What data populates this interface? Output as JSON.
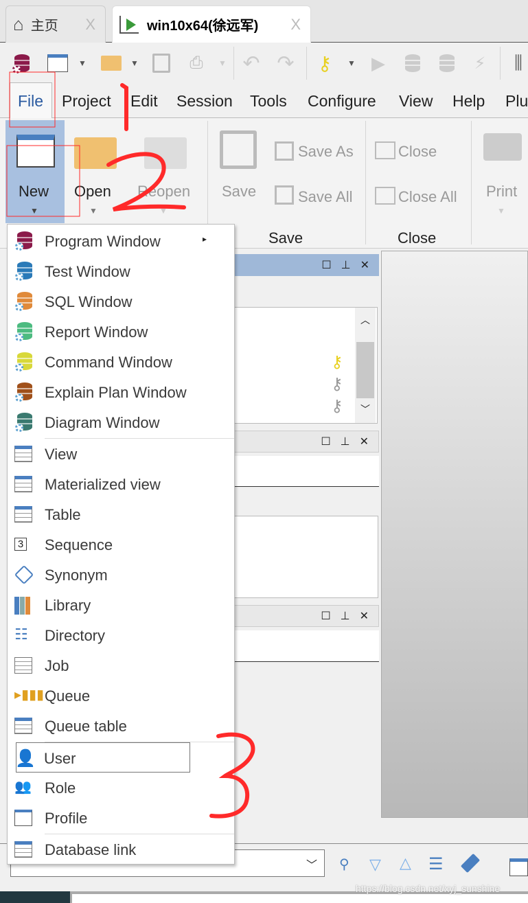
{
  "tabs": [
    {
      "label": "主页",
      "icon": "home-icon",
      "close": "X"
    },
    {
      "label": "win10x64(徐远军)",
      "icon": "session-play-icon",
      "close": "X",
      "active": true
    }
  ],
  "toolbar": {
    "icons": [
      "database-gear-icon",
      "new-window-icon",
      "dropdown-arrow-icon",
      "open-folder-icon",
      "dropdown-arrow-icon",
      "save-icon",
      "print-icon",
      "dropdown-arrow-icon",
      "undo-icon",
      "redo-icon",
      "key-icon",
      "dropdown-arrow-icon",
      "execute-icon",
      "commit-icon",
      "rollback-icon",
      "break-icon",
      "settings-icon"
    ]
  },
  "menubar": [
    "File",
    "Project",
    "Edit",
    "Session",
    "Tools",
    "Configure",
    "View",
    "Help",
    "Plu"
  ],
  "ribbon": {
    "new": "New",
    "open": "Open",
    "reopen": "Reopen",
    "save": "Save",
    "save_as": "Save As",
    "save_all": "Save All",
    "close": "Close",
    "close_all": "Close All",
    "print": "Print",
    "group_save": "Save",
    "group_close": "Close"
  },
  "menu": {
    "items": [
      {
        "label": "Program Window",
        "color": "#8b1a4a",
        "type": "db",
        "submenu": true
      },
      {
        "label": "Test Window",
        "color": "#2a7ab8",
        "type": "db"
      },
      {
        "label": "SQL Window",
        "color": "#e08a3a",
        "type": "db"
      },
      {
        "label": "Report Window",
        "color": "#4cbb80",
        "type": "db"
      },
      {
        "label": "Command Window",
        "color": "#d8d83a",
        "type": "db"
      },
      {
        "label": "Explain Plan Window",
        "color": "#a0501a",
        "type": "db"
      },
      {
        "label": "Diagram Window",
        "color": "#3a7a70",
        "type": "db"
      },
      {
        "label": "View",
        "type": "grid"
      },
      {
        "label": "Materialized view",
        "type": "grid"
      },
      {
        "label": "Table",
        "type": "grid"
      },
      {
        "label": "Sequence",
        "type": "seq"
      },
      {
        "label": "Synonym",
        "type": "tag"
      },
      {
        "label": "Library",
        "type": "books"
      },
      {
        "label": "Directory",
        "type": "tree"
      },
      {
        "label": "Job",
        "type": "clock"
      },
      {
        "label": "Queue",
        "type": "queue"
      },
      {
        "label": "Queue table",
        "type": "grid"
      },
      {
        "label": "User",
        "type": "user",
        "highlighted": true
      },
      {
        "label": "Role",
        "type": "role"
      },
      {
        "label": "Profile",
        "type": "window"
      },
      {
        "label": "Database link",
        "type": "grid"
      }
    ]
  },
  "panel_buttons": {
    "restore": "☐",
    "pin": "📌",
    "close": "✕"
  },
  "bottom": {
    "icons": [
      "find-icon",
      "next-icon",
      "previous-icon",
      "list-icon",
      "eraser-icon",
      "window-icon"
    ]
  },
  "watermark": "https://blog.csdn.net/xyj_sunshine",
  "annotations": [
    "1",
    "2",
    "3"
  ],
  "colors": {
    "accent": "#9fb8d8",
    "annotation": "#ff2a2a"
  }
}
